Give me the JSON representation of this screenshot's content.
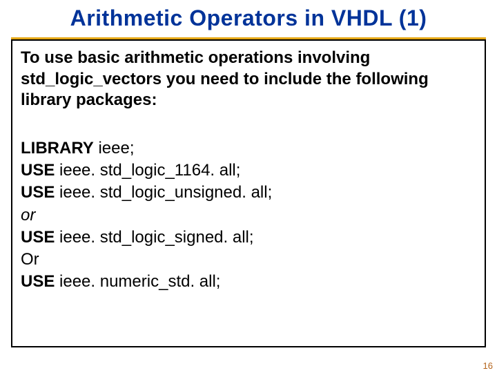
{
  "title": "Arithmetic Operators in VHDL (1)",
  "intro": "To use basic arithmetic operations involving std_logic_vectors you need to include the following library packages:",
  "code": {
    "l1_kw": "LIBRARY",
    "l1_rest": " ieee;",
    "l2_kw": "USE",
    "l2_rest": " ieee. std_logic_1164. all;",
    "l3_kw": "USE",
    "l3_rest": " ieee. std_logic_unsigned. all;",
    "l4": "or",
    "l5_kw": "USE",
    "l5_rest": " ieee. std_logic_signed. all;",
    "l6": "Or",
    "l7_kw": "USE",
    "l7_rest": " ieee. numeric_std. all;"
  },
  "page_number": "16"
}
